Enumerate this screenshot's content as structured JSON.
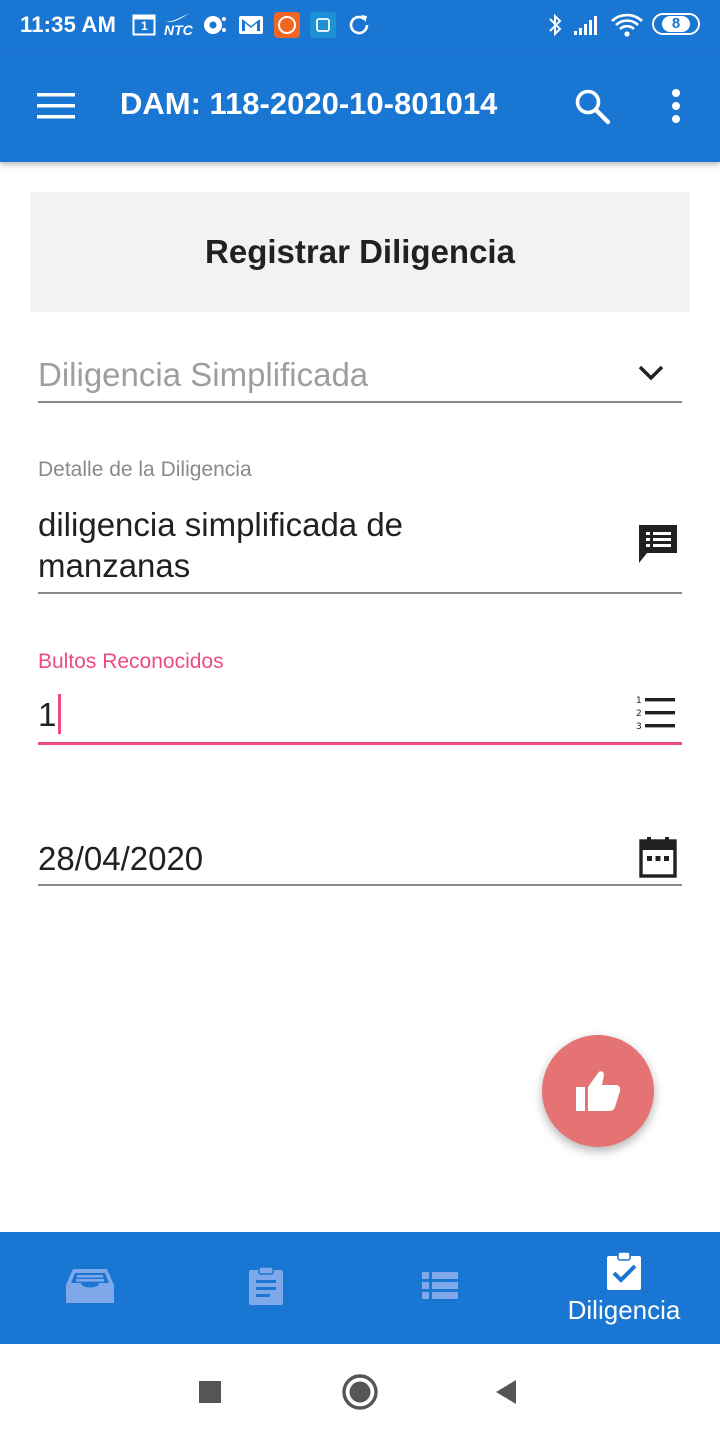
{
  "status_bar": {
    "time": "11:35 AM",
    "calendar_day": "1",
    "ntc_label": "NTC",
    "battery_level": "8",
    "icons": [
      "calendar-icon",
      "nike-ntc-icon",
      "pokeball-icon",
      "gmail-icon",
      "app-orange-icon",
      "app-blue-icon",
      "sync-icon",
      "bluetooth-icon",
      "signal-icon",
      "wifi-icon",
      "battery-icon"
    ]
  },
  "app_bar": {
    "title": "DAM: 118-2020-10-801014",
    "menu_icon": "menu-icon",
    "search_icon": "search-icon",
    "more_icon": "more-vert-icon"
  },
  "section": {
    "title": "Registrar Diligencia"
  },
  "form": {
    "tipo": {
      "value": "Diligencia Simplificada",
      "icon": "chevron-down-icon"
    },
    "detalle": {
      "label": "Detalle de la Diligencia",
      "value_line1": "diligencia simplificada de",
      "value_line2": "manzanas",
      "icon": "comment-list-icon"
    },
    "bultos": {
      "label": "Bultos Reconocidos",
      "value": "1",
      "icon": "numbered-list-icon"
    },
    "fecha": {
      "value": "28/04/2020",
      "icon": "calendar-icon"
    }
  },
  "fab": {
    "icon": "thumb-up-icon"
  },
  "bottom_nav": {
    "items": [
      {
        "icon": "inbox-icon",
        "label": ""
      },
      {
        "icon": "clipboard-icon",
        "label": ""
      },
      {
        "icon": "list-icon",
        "label": ""
      },
      {
        "icon": "assignment-check-icon",
        "label": "Diligencia"
      }
    ],
    "active_index": 3
  },
  "system_nav": {
    "icons": [
      "recents-icon",
      "home-icon",
      "back-icon"
    ]
  },
  "colors": {
    "primary": "#1976d2",
    "accent": "#ef4a81",
    "fab": "#e57373",
    "inactive_nav": "#7fa8ea"
  }
}
